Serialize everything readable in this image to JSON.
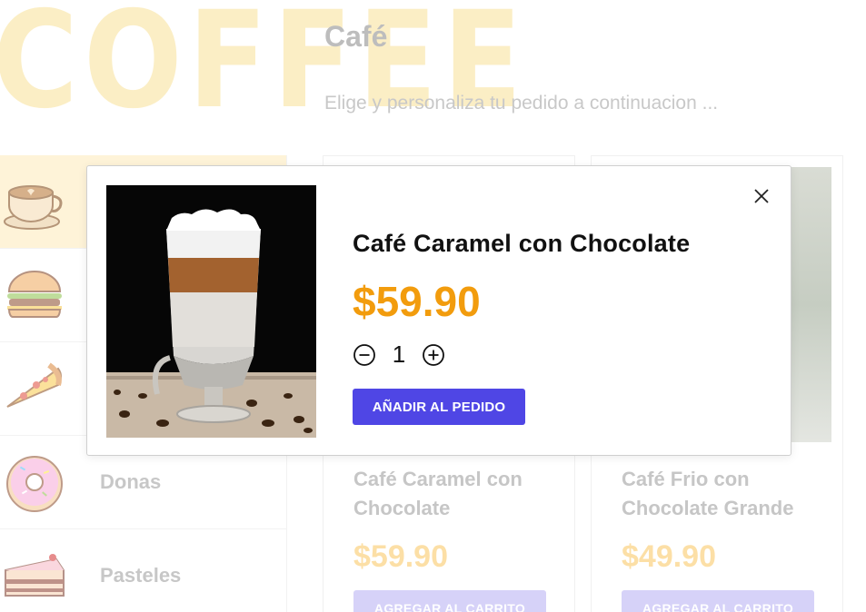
{
  "brand": {
    "logo_text": "COFFEE"
  },
  "header": {
    "title": "Café",
    "subtitle": "Elige y personaliza tu pedido a continuacion ..."
  },
  "sidebar": {
    "items": [
      {
        "icon": "coffee-cup-icon",
        "label": ""
      },
      {
        "icon": "burger-icon",
        "label": ""
      },
      {
        "icon": "pizza-icon",
        "label": ""
      },
      {
        "icon": "donut-icon",
        "label": "Donas"
      },
      {
        "icon": "cake-icon",
        "label": "Pasteles"
      }
    ]
  },
  "products": [
    {
      "name": "Café Caramel con Chocolate",
      "price": "$59.90",
      "button": "AGREGAR AL CARRITO"
    },
    {
      "name": "Café Frio con Chocolate Grande",
      "price": "$49.90",
      "button": "AGREGAR AL CARRITO"
    }
  ],
  "modal": {
    "title": "Café Caramel con Chocolate",
    "price": "$59.90",
    "quantity": "1",
    "add_button": "AÑADIR AL PEDIDO"
  },
  "colors": {
    "accent": "#4f46e5",
    "price": "#f29c0d",
    "active_category": "#fef3d8"
  }
}
